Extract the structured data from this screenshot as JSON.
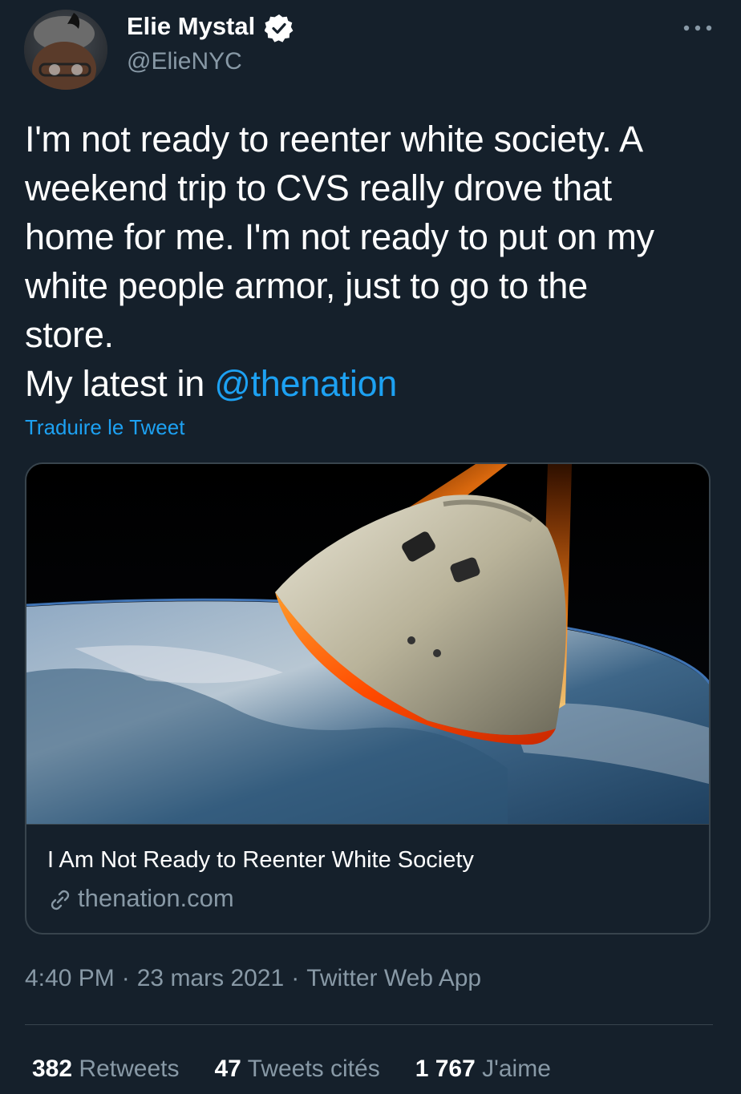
{
  "author": {
    "name": "Elie Mystal",
    "handle": "@ElieNYC",
    "verified": true
  },
  "tweet": {
    "text_lines": [
      "I'm not ready to reenter white society. A",
      "weekend trip to CVS really drove that",
      "home for me. I'm not ready to put on my",
      "white people armor, just to go to the",
      "store."
    ],
    "latest_prefix": "My latest in ",
    "mention": "@thenation",
    "translate_label": "Traduire le Tweet"
  },
  "card": {
    "title": "I Am Not Ready to Reenter White Society",
    "domain": "thenation.com",
    "image_icon": "space-capsule-reentry-image"
  },
  "meta": {
    "time": "4:40 PM",
    "separator": "·",
    "date": "23 mars 2021",
    "source": "Twitter Web App"
  },
  "stats": {
    "retweets_count": "382",
    "retweets_label": "Retweets",
    "quotes_count": "47",
    "quotes_label": "Tweets cités",
    "likes_count": "1 767",
    "likes_label": "J'aime"
  },
  "colors": {
    "background": "#15202b",
    "accent": "#1da1f2",
    "muted": "#8899a6",
    "border": "#38444d"
  },
  "icons": [
    "verified-badge-icon",
    "more-options-icon",
    "link-icon"
  ]
}
